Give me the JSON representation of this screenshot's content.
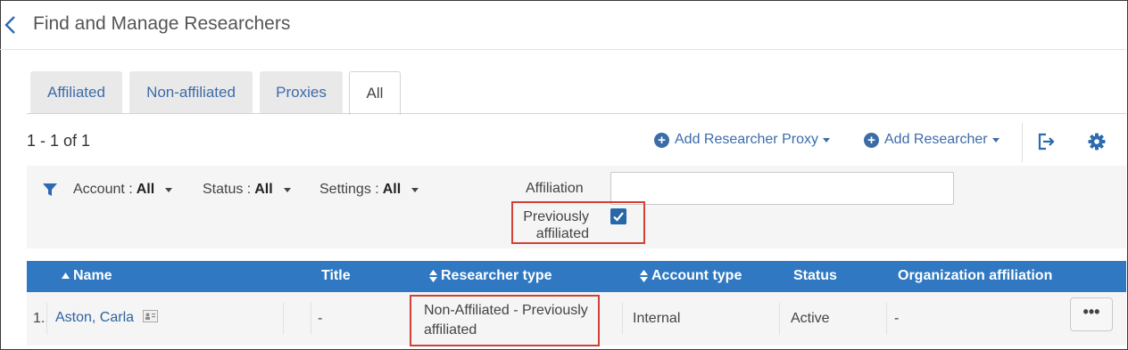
{
  "header": {
    "title": "Find and Manage Researchers"
  },
  "tabs": [
    {
      "label": "Affiliated"
    },
    {
      "label": "Non-affiliated"
    },
    {
      "label": "Proxies"
    },
    {
      "label": "All"
    }
  ],
  "toolbar": {
    "count": "1 - 1 of 1",
    "add_proxy_label": "Add Researcher Proxy",
    "add_researcher_label": "Add Researcher"
  },
  "filters": {
    "account": {
      "label": "Account :",
      "value": "All"
    },
    "status": {
      "label": "Status :",
      "value": "All"
    },
    "settings": {
      "label": "Settings :",
      "value": "All"
    },
    "affiliation_label": "Affiliation",
    "affiliation_value": "",
    "previously_affiliated_label": "Previously affiliated",
    "previously_affiliated_checked": true
  },
  "table": {
    "columns": [
      "Name",
      "Title",
      "Researcher type",
      "Account type",
      "Status",
      "Organization affiliation"
    ],
    "rows": [
      {
        "index": "1",
        "name": "Aston, Carla",
        "title": "-",
        "researcher_type": "Non-Affiliated - Previously affiliated",
        "account_type": "Internal",
        "status": "Active",
        "organization_affiliation": "-",
        "actions_label": "•••"
      }
    ]
  },
  "colors": {
    "accent": "#3c6ca8",
    "table_header": "#3079c2",
    "highlight_box": "#d0413a"
  }
}
